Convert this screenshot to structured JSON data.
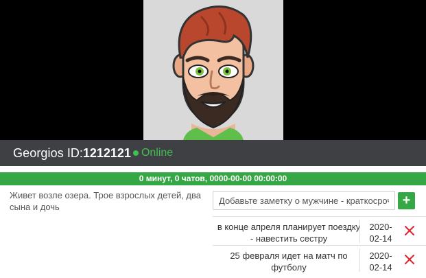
{
  "profile": {
    "name": "Georgios",
    "id_label": "ID:",
    "id_value": "1212121",
    "status": "Online",
    "avatar_icon": "cartoon-man-avatar"
  },
  "stats": {
    "summary": "0 минут, 0 чатов, 0000-00-00 00:00:00"
  },
  "about": {
    "text": "Живет возле озера. Трое взрослых детей, два сына и дочь"
  },
  "note_form": {
    "placeholder": "Добавьте заметку о мужчине - краткосрочно",
    "add_label": "+"
  },
  "notes": [
    {
      "text": "в конце апреля планирует поездку - навестить сестру",
      "date": "2020-02-14",
      "delete_icon": "close-icon"
    },
    {
      "text": "25 февраля идет на матч по футболу",
      "date": "2020-02-14",
      "delete_icon": "close-icon"
    }
  ],
  "colors": {
    "accent_green": "#35a845",
    "online_green": "#3fbf52",
    "name_bar": "#3f4043",
    "delete_red": "#e0222b"
  }
}
